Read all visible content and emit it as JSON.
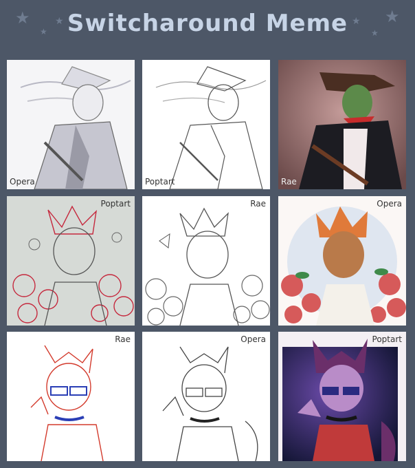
{
  "title": "Switcharound Meme",
  "decor": {
    "star_color": "#6f7c90",
    "background": "#4d5767",
    "title_color": "#c7d4e6"
  },
  "panels": [
    {
      "signature": "Opera",
      "style": "grey-sketch",
      "subject": "cowboy"
    },
    {
      "signature": "Poptart",
      "style": "lineart",
      "subject": "cowboy"
    },
    {
      "signature": "Rae",
      "style": "color",
      "subject": "cowboy"
    },
    {
      "signature": "Poptart",
      "style": "red-sketch",
      "subject": "flowers"
    },
    {
      "signature": "Rae",
      "style": "lineart",
      "subject": "flowers"
    },
    {
      "signature": "Opera",
      "style": "color",
      "subject": "flowers"
    },
    {
      "signature": "Rae",
      "style": "red-sketch",
      "subject": "catboy"
    },
    {
      "signature": "Opera",
      "style": "lineart",
      "subject": "catboy"
    },
    {
      "signature": "Poptart",
      "style": "color",
      "subject": "catboy"
    }
  ]
}
